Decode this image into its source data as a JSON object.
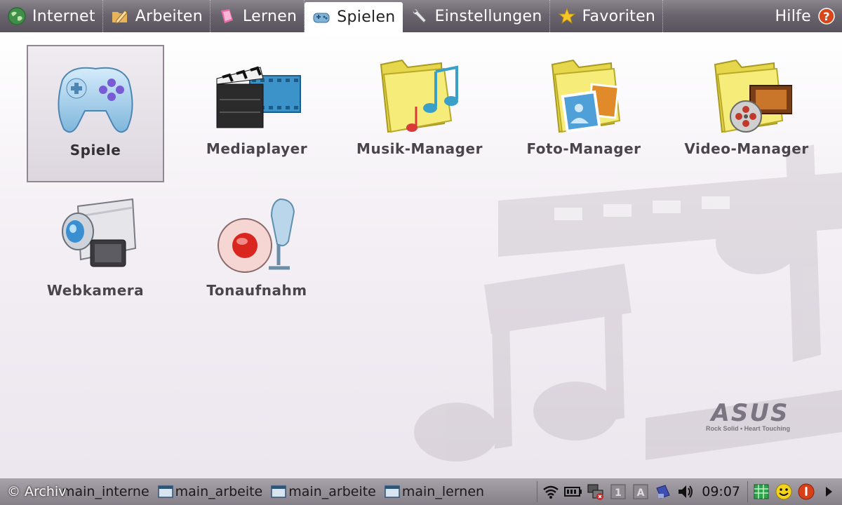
{
  "tabs": [
    {
      "label": "Internet",
      "icon": "globe-icon"
    },
    {
      "label": "Arbeiten",
      "icon": "folder-pencil-icon"
    },
    {
      "label": "Lernen",
      "icon": "book-icon"
    },
    {
      "label": "Spielen",
      "icon": "gamepad-icon",
      "active": true
    },
    {
      "label": "Einstellungen",
      "icon": "wrench-icon"
    },
    {
      "label": "Favoriten",
      "icon": "star-icon"
    }
  ],
  "help": {
    "label": "Hilfe",
    "icon": "help-icon"
  },
  "apps": [
    {
      "label": "Spiele",
      "icon": "gamepad-icon",
      "selected": true
    },
    {
      "label": "Mediaplayer",
      "icon": "clapperboard-icon"
    },
    {
      "label": "Musik-Manager",
      "icon": "music-folder-icon"
    },
    {
      "label": "Foto-Manager",
      "icon": "photo-folder-icon"
    },
    {
      "label": "Video-Manager",
      "icon": "video-folder-icon"
    },
    {
      "label": "Webkamera",
      "icon": "webcam-icon"
    },
    {
      "label": "Tonaufnahm",
      "icon": "microphone-record-icon"
    }
  ],
  "logo": {
    "text": "ASUS",
    "tagline": "Rock Solid • Heart Touching"
  },
  "taskbar": {
    "credit": "© Archiv",
    "tasks": [
      {
        "label": "main_interne"
      },
      {
        "label": "main_arbeite"
      },
      {
        "label": "main_arbeite"
      },
      {
        "label": "main_lernen"
      }
    ],
    "clock": "09:07",
    "tray_icons": [
      "wifi-icon",
      "battery-icon",
      "network-icon",
      "keyboard-lock-icon",
      "input-lang-icon",
      "usb-icon",
      "volume-icon",
      "green-grid-icon",
      "smiley-icon",
      "power-icon",
      "arrow-right-icon"
    ]
  },
  "colors": {
    "topbar": "#6a656e",
    "active_tab": "#ffffff",
    "selection_border": "#8f8892",
    "taskbar": "#958f97",
    "help_icon": "#d9461a"
  }
}
